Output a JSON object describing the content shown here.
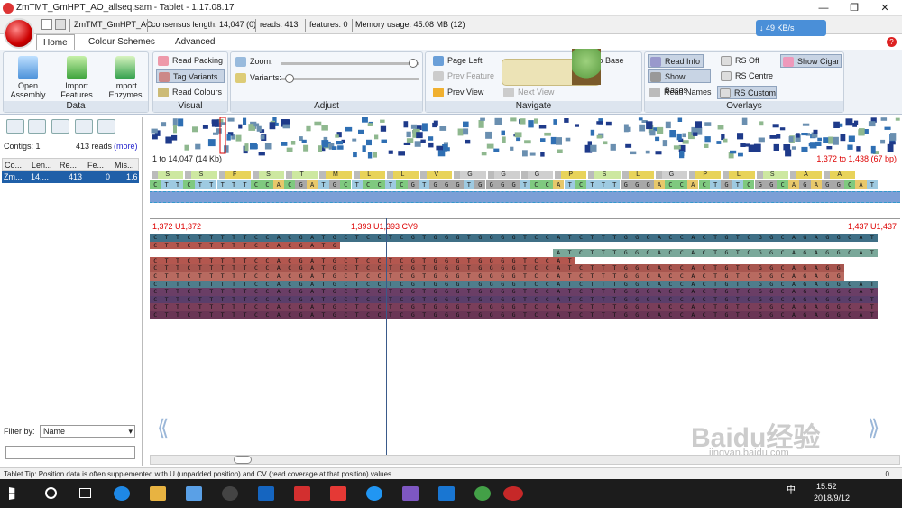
{
  "window": {
    "title": "ZmTMT_GmHPT_AO_allseq.sam - Tablet - 1.17.08.17",
    "minimize": "—",
    "maximize": "❐",
    "close": "✕"
  },
  "status": {
    "contig": "ZmTMT_GmHPT_AO",
    "consensus": "consensus length: 14,047 (0)",
    "reads": "reads: 413",
    "features": "features: 0",
    "memory": "Memory usage: 45.08 MB (12)",
    "net": "49 KB/s"
  },
  "tabs": [
    {
      "label": "Home"
    },
    {
      "label": "Colour Schemes"
    },
    {
      "label": "Advanced"
    }
  ],
  "ribbon": {
    "data": {
      "label": "Data",
      "open": "Open\nAssembly",
      "import_features": "Import\nFeatures",
      "import_enzymes": "Import\nEnzymes"
    },
    "visual": {
      "label": "Visual",
      "read_packing": "Read Packing",
      "tag_variants": "Tag Variants",
      "read_colours": "Read Colours"
    },
    "adjust": {
      "label": "Adjust",
      "zoom": "Zoom:",
      "variants": "Variants:",
      "zoom_level": 0.92,
      "variants_level": 0.03
    },
    "navigate": {
      "label": "Navigate",
      "page_left": "Page Left",
      "prev_feature": "Prev Feature",
      "prev_view": "Prev View",
      "next_view": "Next View",
      "jump": "mp to Base"
    },
    "overlays": {
      "label": "Overlays",
      "read_info": "Read Info",
      "show_bases": "Show Bases",
      "read_names": "Read Names",
      "rs_off": "RS Off",
      "rs_centre": "RS Centre",
      "rs_custom": "RS Custom",
      "show_cigar": "Show Cigar"
    }
  },
  "left": {
    "contigs_label": "Contigs: 1",
    "reads_label": "413 reads",
    "more": "(more)",
    "columns": [
      "Co...",
      "Len...",
      "Re...",
      "Fe...",
      "Mis..."
    ],
    "rows": [
      [
        "Zm...",
        "14,...",
        "413",
        "0",
        "1.6"
      ]
    ],
    "filter_label": "Filter by:",
    "filter_value": "Name"
  },
  "overview": {
    "range_left": "1 to 14,047 (14 Kb)",
    "range_right": "1,372 to 1,438 (67 bp)"
  },
  "ruler": {
    "left": "1,372 U1,372",
    "center": "1,393 U1,393 CV9",
    "right": "1,437 U1,437"
  },
  "protein": "S S F S T M L L V G G G P S L G P L S A A",
  "consensus_seq": "CTTCTTTTTCCACGATGCTCCTCGTGGGTGGGGTCCATCTTTGGGACCACTGTCGGCAGAGGCAT",
  "reads": [
    {
      "seq": "CTTCTTTTTCCACGATGCTCCTCGTGGGTGGGGTCCATCTTTGGGACCACTGTCGGCAGAGGCAT",
      "start": 0,
      "color": "#3f6f86"
    },
    {
      "seq": "CTTCTTTTTCCACGATG",
      "start": 0,
      "color": "#b4574f"
    },
    {
      "seq": "ATCTTTGGGACCACTGTCGGCAGAGGCAT",
      "start": 36,
      "color": "#7aa89a"
    },
    {
      "seq": "CTTCTTTTTCCACGATGCTCCTCGTGGGTGGGGTCCAT",
      "start": 0,
      "color": "#b4574f"
    },
    {
      "seq": "CTTCTTTTTCCACGATGCTCCTCGTGGGTGGGGTCCATCTTTGGGACCACTGTCGGCAGAGG",
      "start": 0,
      "color": "#a8564f"
    },
    {
      "seq": "CTTCTTTTTCCACGATGCTCCTCGTGGGTGGGGTCCATCTTTGGGACCACTGTCGGCAGAGG",
      "start": 0,
      "color": "#b86a60"
    },
    {
      "seq": "CTTCTTTTTCCACGATGCTCCTCGTGGGTGGGGTCCATCTTTGGGACCACTGTCGGCAGAGGCAT",
      "start": 0,
      "color": "#4f7d8c"
    },
    {
      "seq": "CTTCTTTTTCCACGATGCTCCTCGTGGGTGGGGTCCATCTTTGGGACCACTGTCGGCAGAGGCAT",
      "start": 0,
      "color": "#6a3e66"
    },
    {
      "seq": "CTTCTTTTTCCACGATGCTCCTCGTGGGTGGGGTCCATCTTTGGGACCACTGTCGGCAGAGGCAT",
      "start": 0,
      "color": "#5a3e6a"
    },
    {
      "seq": "CTTCTTTTTCCACGATGCTCCTCGTGGGTGGGGTCCATCTTTGGGACCACTGTCGGCAGAGGCAT",
      "start": 0,
      "color": "#7a3e5a"
    },
    {
      "seq": "CTTCTTTTTCCACGATGCTCCTCGTGGGTGGGGTCCATCTTTGGGACCACTGTCGGCAGAGGCAT",
      "start": 0,
      "color": "#6a3555"
    }
  ],
  "tip": "Tablet Tip: Position data is often supplemented with U (unpadded position) and CV (read coverage at that position) values",
  "tip_count": "0",
  "taskbar": {
    "time": "15:52",
    "date": "2018/9/12",
    "ime": "中"
  },
  "watermark": {
    "text": "Baidu经验",
    "url": "jingyan.baidu.com"
  }
}
